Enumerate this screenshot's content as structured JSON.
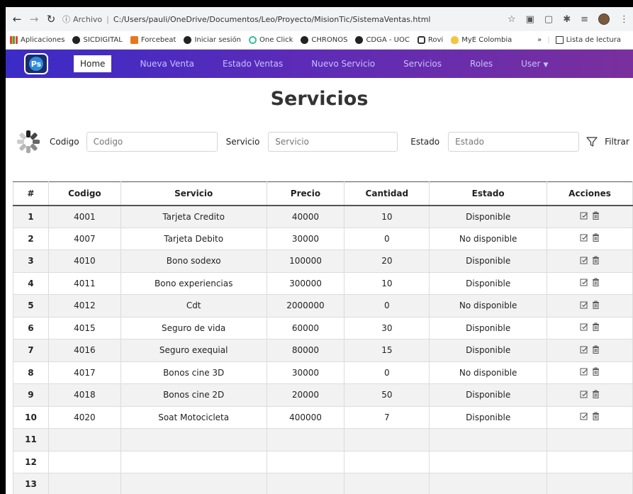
{
  "browser": {
    "scheme": "Archivo",
    "url": "C:/Users/pauli/OneDrive/Documentos/Leo/Proyecto/MisionTic/SistemaVentas.html"
  },
  "bookmarks": [
    "Aplicaciones",
    "SICDIGITAL",
    "Forcebeat",
    "Iniciar sesión",
    "One Click",
    "CHRONOS",
    "CDGA - UOC",
    "Rovi",
    "MyE Colombia"
  ],
  "bookmarks_more": "»",
  "reading_list": "Lista de lectura",
  "nav": {
    "logo": "Ps",
    "items": [
      "Home",
      "Nueva Venta",
      "Estado Ventas",
      "Nuevo Servicio",
      "Servicios",
      "Roles",
      "User"
    ]
  },
  "page_title": "Servicios",
  "filters": {
    "codigo_label": "Codigo",
    "codigo_placeholder": "Codigo",
    "servicio_label": "Servicio",
    "servicio_placeholder": "Servicio",
    "estado_label": "Estado",
    "estado_placeholder": "Estado",
    "filter_button": "Filtrar"
  },
  "table": {
    "headers": [
      "#",
      "Codigo",
      "Servicio",
      "Precio",
      "Cantidad",
      "Estado",
      "Acciones"
    ],
    "rows": [
      [
        "1",
        "4001",
        "Tarjeta Credito",
        "40000",
        "10",
        "Disponible"
      ],
      [
        "2",
        "4007",
        "Tarjeta Debito",
        "30000",
        "0",
        "No disponible"
      ],
      [
        "3",
        "4010",
        "Bono sodexo",
        "100000",
        "20",
        "Disponible"
      ],
      [
        "4",
        "4011",
        "Bono experiencias",
        "300000",
        "10",
        "Disponible"
      ],
      [
        "5",
        "4012",
        "Cdt",
        "2000000",
        "0",
        "No disponible"
      ],
      [
        "6",
        "4015",
        "Seguro de vida",
        "60000",
        "30",
        "Disponible"
      ],
      [
        "7",
        "4016",
        "Seguro exequial",
        "80000",
        "15",
        "Disponible"
      ],
      [
        "8",
        "4017",
        "Bonos cine 3D",
        "30000",
        "0",
        "No disponible"
      ],
      [
        "9",
        "4018",
        "Bonos cine 2D",
        "20000",
        "50",
        "Disponible"
      ],
      [
        "10",
        "4020",
        "Soat Motocicleta",
        "400000",
        "7",
        "Disponible"
      ],
      [
        "11",
        "",
        "",
        "",
        "",
        ""
      ],
      [
        "12",
        "",
        "",
        "",
        "",
        ""
      ],
      [
        "13",
        "",
        "",
        "",
        "",
        ""
      ]
    ]
  },
  "icons": {
    "edit": "edit-icon",
    "delete": "trash-icon"
  },
  "colors": {
    "navbar_start": "#3b2bc6",
    "navbar_end": "#7a2f9d",
    "nav_text": "#c7c0ff"
  }
}
